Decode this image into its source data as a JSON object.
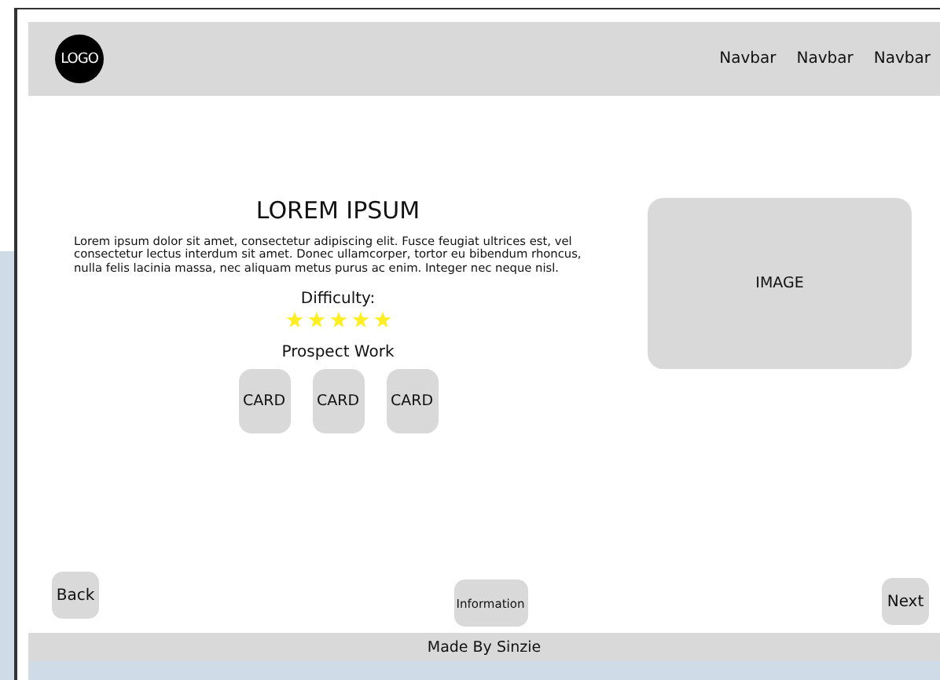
{
  "navbar": {
    "logo": "LOGO",
    "links": [
      "Navbar",
      "Navbar",
      "Navbar"
    ]
  },
  "content": {
    "title": "LOREM IPSUM",
    "text": "Lorem ipsum dolor sit amet, consectetur adipiscing elit. Fusce feugiat ultrices est, vel consectetur lectus interdum sit amet. Donec ullamcorper, tortor eu bibendum rhoncus, nulla felis lacinia massa, nec aliquam metus purus ac enim. Integer nec neque nisl.",
    "difficulty_label": "Difficulty:",
    "difficulty": {
      "stars": 5
    },
    "prospect_label": "Prospect Work",
    "cards": [
      "CARD",
      "CARD",
      "CARD"
    ]
  },
  "image": {
    "label": "IMAGE"
  },
  "buttons": {
    "back": "Back",
    "info": "Information",
    "next": "Next"
  },
  "footer": "Made By Sinzie"
}
